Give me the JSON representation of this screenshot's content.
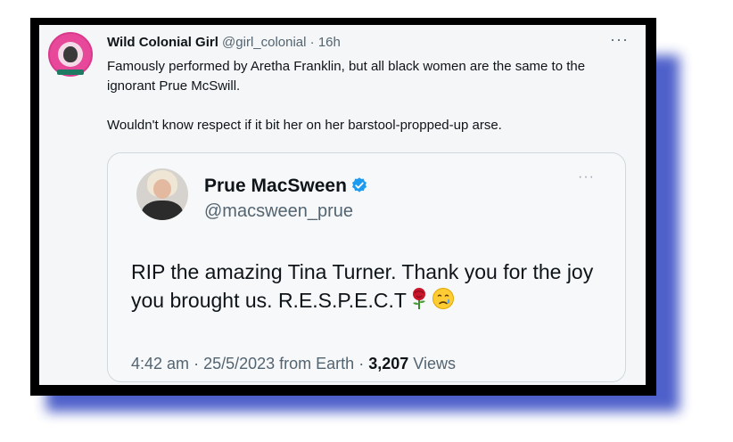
{
  "tweet": {
    "author_name": "Wild Colonial Girl",
    "handle": "@girl_colonial",
    "separator": "·",
    "time_ago": "16h",
    "more_icon": "more-horizontal-icon",
    "paragraphs": [
      "Famously performed by Aretha Franklin, but all black women are the same to the ignorant Prue McSwill.",
      "Wouldn't know respect if it bit her on her barstool-propped-up arse."
    ]
  },
  "quoted": {
    "author_name": "Prue MacSween",
    "verified_icon": "verified-badge-icon",
    "handle": "@macsween_prue",
    "text": "RIP the amazing Tina Turner. Thank you for the joy you brought us.  R.E.S.P.E.C.T",
    "emojis": [
      "rose-emoji",
      "crying-face-emoji"
    ],
    "time": "4:42 am",
    "date": "25/5/2023 from Earth",
    "views_count": "3,207",
    "views_label": "Views"
  },
  "colors": {
    "shadow": "#3b4fc4",
    "verified_blue": "#1d9bf0",
    "text_primary": "#0f1419",
    "text_secondary": "#536471"
  }
}
